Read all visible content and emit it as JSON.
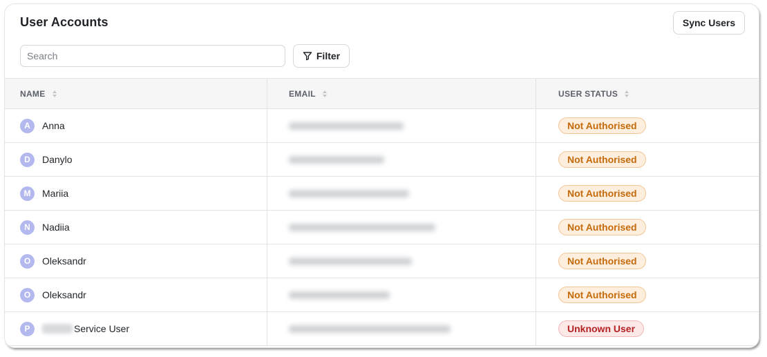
{
  "header": {
    "title": "User Accounts",
    "sync_label": "Sync Users"
  },
  "search": {
    "placeholder": "Search",
    "value": ""
  },
  "filter": {
    "label": "Filter",
    "icon": "funnel-icon"
  },
  "columns": [
    "NAME",
    "EMAIL",
    "USER STATUS"
  ],
  "rows": [
    {
      "initial": "A",
      "name": "Anna",
      "status": "Not Authorised",
      "status_type": "warning"
    },
    {
      "initial": "D",
      "name": "Danylo",
      "status": "Not Authorised",
      "status_type": "warning"
    },
    {
      "initial": "M",
      "name": "Mariia",
      "status": "Not Authorised",
      "status_type": "warning"
    },
    {
      "initial": "N",
      "name": "Nadiia",
      "status": "Not Authorised",
      "status_type": "warning"
    },
    {
      "initial": "O",
      "name": "Oleksandr",
      "status": "Not Authorised",
      "status_type": "warning"
    },
    {
      "initial": "O",
      "name": "Oleksandr",
      "status": "Not Authorised",
      "status_type": "warning"
    },
    {
      "initial": "P",
      "name": "Service User",
      "status": "Unknown User",
      "status_type": "error"
    }
  ],
  "colors": {
    "avatar_bg": "#b3b9ee",
    "warning_text": "#c56a0a",
    "warning_bg": "#fdeedd",
    "error_text": "#b42121",
    "error_bg": "#fde8e8"
  }
}
